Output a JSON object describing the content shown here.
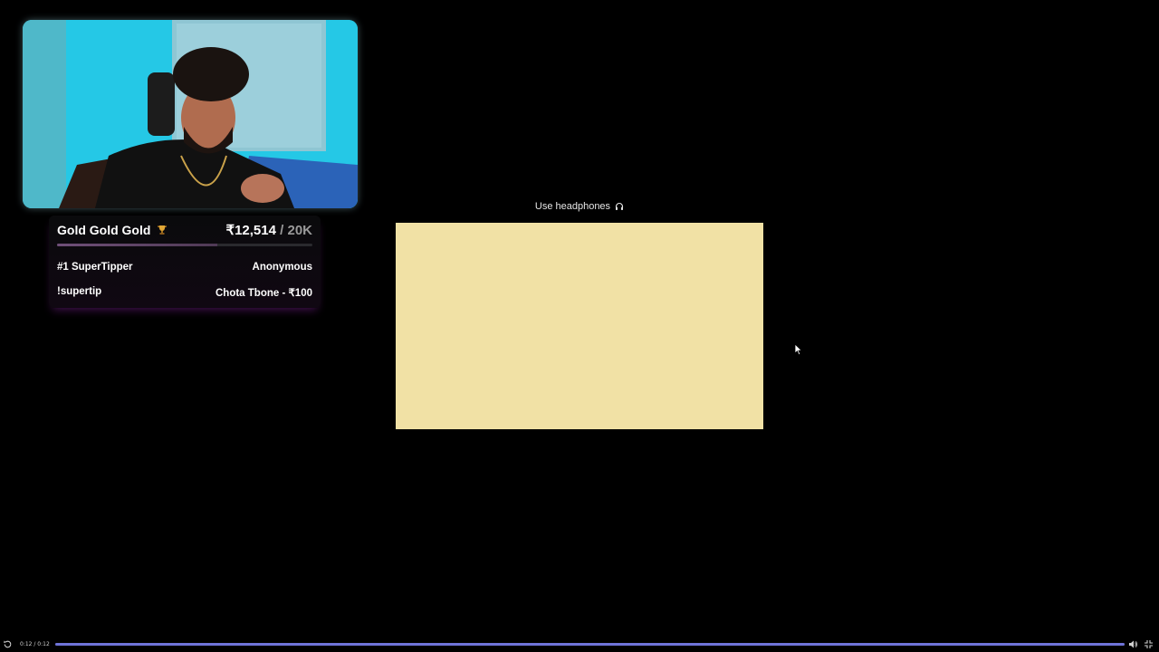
{
  "webcam": {
    "description_icon": "webcam-feed"
  },
  "goal": {
    "title": "Gold Gold Gold",
    "title_icon": "trophy-icon",
    "amount": "₹12,514",
    "target": " / 20K",
    "progress_fraction": 0.626,
    "top_tipper_label": "#1 SuperTipper",
    "top_tipper_value": "Anonymous",
    "command_label": "!supertip",
    "command_value": "Chota Tbone - ₹100"
  },
  "notice": {
    "text": "Use headphones",
    "icon": "headphones-icon"
  },
  "player": {
    "time": "0:12 / 0:12",
    "progress_fraction": 1.0,
    "colors": {
      "track": "#3a3a5a",
      "fill": "#6e73d8"
    }
  },
  "colors": {
    "embed_background": "#f1e1a5",
    "page_background": "#000000"
  }
}
